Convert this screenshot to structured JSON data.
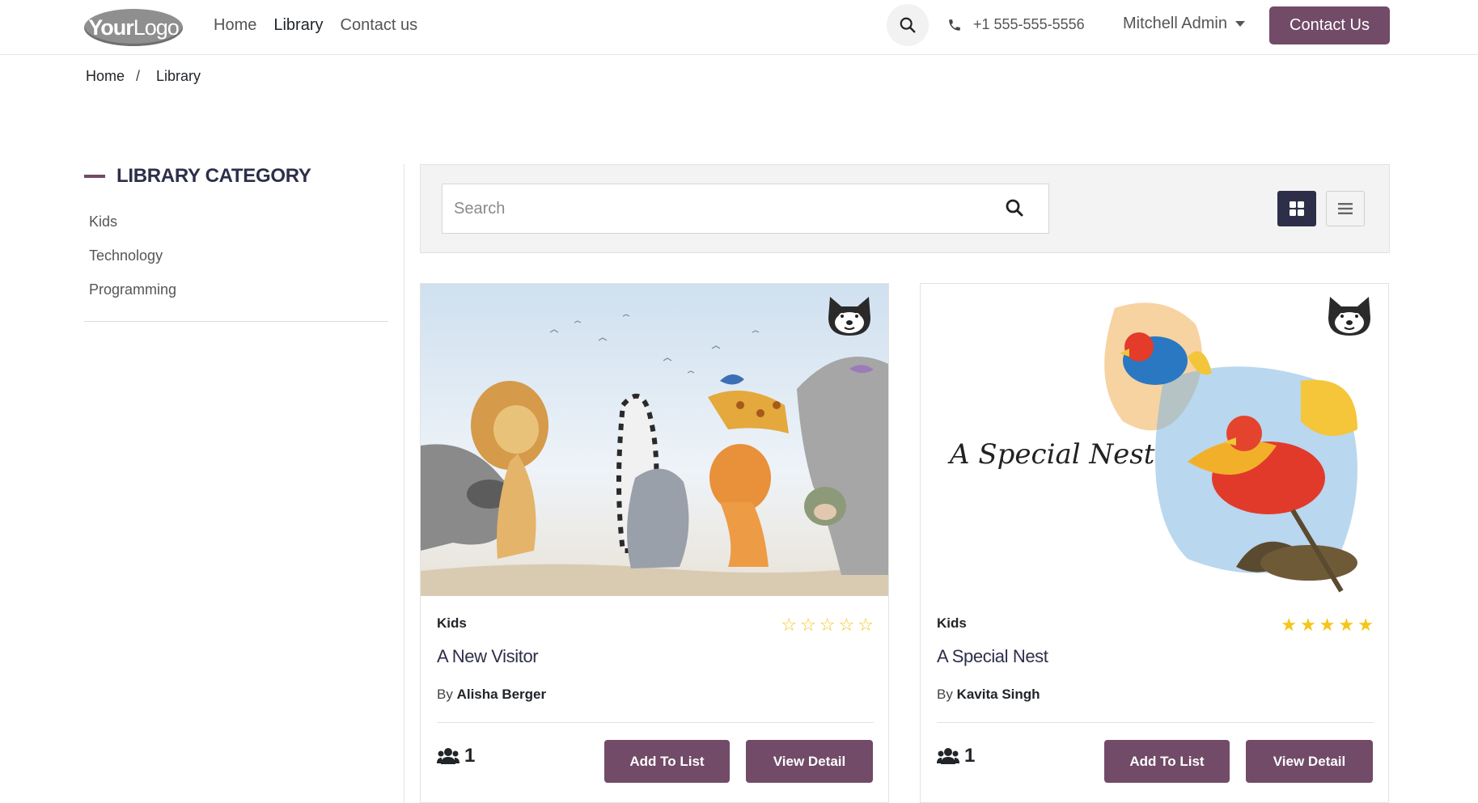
{
  "header": {
    "logo_bold": "Your",
    "logo_light": "Logo",
    "nav": [
      {
        "label": "Home",
        "active": false
      },
      {
        "label": "Library",
        "active": true
      },
      {
        "label": "Contact us",
        "active": false
      }
    ],
    "phone": "+1 555-555-5556",
    "user": "Mitchell Admin",
    "contact_button": "Contact Us"
  },
  "breadcrumb": [
    "Home",
    "/",
    "Library"
  ],
  "sidebar": {
    "title": "LIBRARY CATEGORY",
    "categories": [
      "Kids",
      "Technology",
      "Programming"
    ]
  },
  "toolbar": {
    "search_placeholder": "Search",
    "views": [
      "grid-view-icon",
      "list-view-icon"
    ],
    "active_view": "grid"
  },
  "books": [
    {
      "category": "Kids",
      "title": "A New Visitor",
      "author_prefix": "By",
      "author": "Alisha Berger",
      "rating": 0,
      "members": "1",
      "add_label": "Add To List",
      "view_label": "View Detail",
      "cover_text": ""
    },
    {
      "category": "Kids",
      "title": "A Special Nest",
      "author_prefix": "By",
      "author": "Kavita Singh",
      "rating": 5,
      "members": "1",
      "add_label": "Add To List",
      "view_label": "View Detail",
      "cover_text": "A Special Nest"
    }
  ],
  "colors": {
    "primary": "#714b67",
    "dark_navy": "#2d2f49",
    "star": "#f5c518"
  }
}
